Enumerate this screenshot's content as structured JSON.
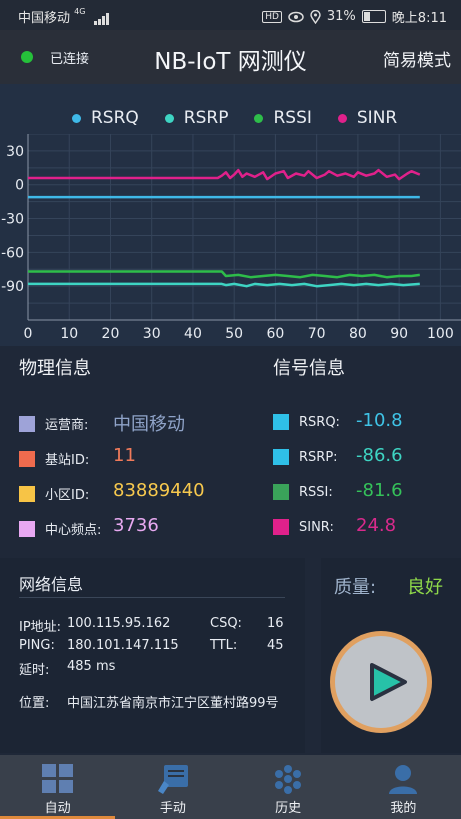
{
  "status_bar": {
    "carrier": "中国移动",
    "network": "4G",
    "hd": "HD",
    "battery": "31%",
    "battery_level": 0.31,
    "time": "晚上8:11"
  },
  "header": {
    "connection": "已连接",
    "title": "NB-IoT 网测仪",
    "mode": "简易模式"
  },
  "colors": {
    "rsrq": "#3fb9e8",
    "rsrp": "#3ed4c3",
    "rssi": "#2ebd4a",
    "sinr": "#e0218b",
    "accent": "#e08a3c"
  },
  "chart_data": {
    "type": "line",
    "x_ticks": [
      0,
      10,
      20,
      30,
      40,
      50,
      60,
      70,
      80,
      90,
      100
    ],
    "y_ticks": [
      30,
      0,
      -30,
      -60,
      -90
    ],
    "xlim": [
      0,
      105
    ],
    "ylim": [
      -120,
      45
    ],
    "grid": true,
    "legend_position": "top",
    "series": [
      {
        "name": "RSRQ",
        "color": "#3fb9e8",
        "points": [
          [
            0,
            -11
          ],
          [
            47,
            -11
          ],
          [
            50,
            -11
          ],
          [
            60,
            -11
          ],
          [
            70,
            -11
          ],
          [
            80,
            -11
          ],
          [
            95,
            -11
          ]
        ]
      },
      {
        "name": "RSRP",
        "color": "#3ed4c3",
        "points": [
          [
            0,
            -88
          ],
          [
            47,
            -88
          ],
          [
            48,
            -89
          ],
          [
            50,
            -88
          ],
          [
            53,
            -90
          ],
          [
            55,
            -88
          ],
          [
            58,
            -89
          ],
          [
            61,
            -88
          ],
          [
            64,
            -89
          ],
          [
            67,
            -88
          ],
          [
            70,
            -90
          ],
          [
            73,
            -89
          ],
          [
            76,
            -88
          ],
          [
            79,
            -89
          ],
          [
            82,
            -88
          ],
          [
            85,
            -89
          ],
          [
            88,
            -88
          ],
          [
            91,
            -89
          ],
          [
            95,
            -88
          ]
        ]
      },
      {
        "name": "RSSI",
        "color": "#2ebd4a",
        "points": [
          [
            0,
            -77
          ],
          [
            47,
            -77
          ],
          [
            48,
            -81
          ],
          [
            51,
            -80
          ],
          [
            54,
            -82
          ],
          [
            57,
            -81
          ],
          [
            60,
            -80
          ],
          [
            63,
            -81
          ],
          [
            66,
            -82
          ],
          [
            69,
            -80
          ],
          [
            72,
            -81
          ],
          [
            75,
            -82
          ],
          [
            78,
            -80
          ],
          [
            81,
            -81
          ],
          [
            84,
            -80
          ],
          [
            87,
            -82
          ],
          [
            90,
            -81
          ],
          [
            93,
            -81
          ],
          [
            95,
            -80
          ]
        ]
      },
      {
        "name": "SINR",
        "color": "#e0218b",
        "points": [
          [
            0,
            6
          ],
          [
            46,
            6
          ],
          [
            47,
            8
          ],
          [
            48,
            11
          ],
          [
            49,
            6
          ],
          [
            50,
            9
          ],
          [
            51,
            13
          ],
          [
            52,
            7
          ],
          [
            53,
            10
          ],
          [
            55,
            7
          ],
          [
            57,
            11
          ],
          [
            58,
            5
          ],
          [
            60,
            10
          ],
          [
            62,
            12
          ],
          [
            63,
            6
          ],
          [
            65,
            10
          ],
          [
            67,
            8
          ],
          [
            68,
            12
          ],
          [
            70,
            6
          ],
          [
            72,
            9
          ],
          [
            73,
            12
          ],
          [
            75,
            8
          ],
          [
            77,
            10
          ],
          [
            79,
            7
          ],
          [
            80,
            11
          ],
          [
            82,
            8
          ],
          [
            84,
            10
          ],
          [
            85,
            13
          ],
          [
            87,
            7
          ],
          [
            89,
            9
          ],
          [
            90,
            5
          ],
          [
            92,
            10
          ],
          [
            93,
            12
          ],
          [
            95,
            9
          ]
        ]
      }
    ]
  },
  "physical": {
    "title": "物理信息",
    "rows": [
      {
        "label": "运营商:",
        "value": "中国移动",
        "color": "#9ea3d8",
        "val_color": "#8fa3c8"
      },
      {
        "label": "基站ID:",
        "value": "11",
        "color": "#ef6b4e",
        "val_color": "#f07a5a"
      },
      {
        "label": "小区ID:",
        "value": "83889440",
        "color": "#f7c446",
        "val_color": "#f7c94e"
      },
      {
        "label": "中心频点:",
        "value": "3736",
        "color": "#e8a8f2",
        "val_color": "#e7a9f0"
      }
    ]
  },
  "signal": {
    "title": "信号信息",
    "rows": [
      {
        "label": "RSRQ:",
        "value": "-10.8",
        "color": "#2fc0e8",
        "val_color": "#3fc3e6"
      },
      {
        "label": "RSRP:",
        "value": "-86.6",
        "color": "#2fc0e8",
        "val_color": "#3ed4c3"
      },
      {
        "label": "RSSI:",
        "value": "-81.6",
        "color": "#3aa35a",
        "val_color": "#35c25a"
      },
      {
        "label": "SINR:",
        "value": "24.8",
        "color": "#e0218b",
        "val_color": "#d82a8c"
      }
    ]
  },
  "network": {
    "title": "网络信息",
    "ip_label": "IP地址:",
    "ip": "100.115.95.162",
    "csq_label": "CSQ:",
    "csq": "16",
    "ping_label": "PING:",
    "ping": "180.101.147.115",
    "ttl_label": "TTL:",
    "ttl": "45",
    "delay_label": "延时:",
    "delay": "485 ms",
    "location_label": "位置:",
    "location": "中国江苏省南京市江宁区董村路99号"
  },
  "quality": {
    "label": "质量:",
    "value": "良好"
  },
  "tabs": [
    {
      "label": "自动",
      "icon": "grid-icon",
      "active": true
    },
    {
      "label": "手动",
      "icon": "edit-icon",
      "active": false
    },
    {
      "label": "历史",
      "icon": "history-icon",
      "active": false
    },
    {
      "label": "我的",
      "icon": "user-icon",
      "active": false
    }
  ]
}
